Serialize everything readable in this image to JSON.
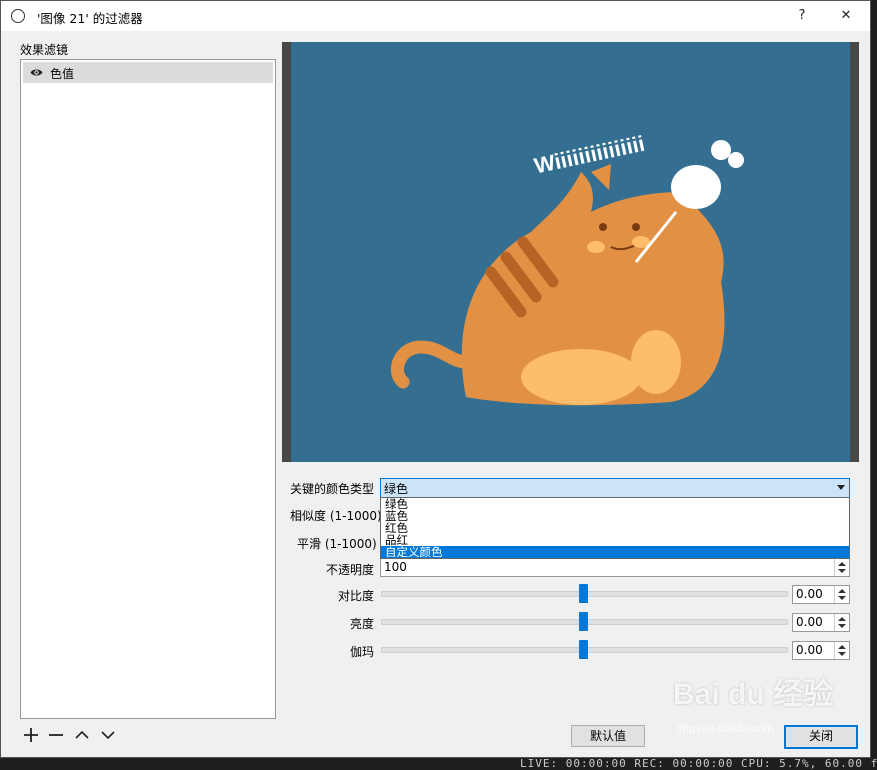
{
  "window": {
    "title": "'图像 21' 的过滤器",
    "help_label": "?",
    "close_label": "✕"
  },
  "left_panel": {
    "label": "效果滤镜",
    "filters": [
      {
        "name": "色值",
        "visible": true,
        "selected": true
      }
    ],
    "controls": {
      "add": "+",
      "remove": "−",
      "up": "up-chevron",
      "down": "down-chevron"
    }
  },
  "properties": {
    "key_color_type": {
      "label": "关键的颜色类型",
      "value": "绿色",
      "options": [
        "绿色",
        "蓝色",
        "红色",
        "品红",
        "自定义颜色"
      ],
      "highlighted": "自定义颜色"
    },
    "similarity_label": "相似度 (1-1000)",
    "smoothness_label": "平滑 (1-1000)",
    "opacity": {
      "label": "不透明度",
      "value": "100"
    },
    "contrast": {
      "label": "对比度",
      "value": "0.00",
      "level": 0.5
    },
    "brightness": {
      "label": "亮度",
      "value": "0.00",
      "level": 0.5
    },
    "gamma": {
      "label": "伽玛",
      "value": "0.00",
      "level": 0.5
    }
  },
  "buttons": {
    "defaults": "默认值",
    "close": "关闭"
  },
  "preview": {
    "text": "Wiiiiiiiiiiiiiii"
  },
  "status_bar": "LIVE: 00:00:00   REC: 00:00:00   CPU: 5.7%, 60.00 f",
  "watermark": {
    "brand": "Bai du 经验",
    "url": "jingyan.baidu.com"
  },
  "colors": {
    "accent": "#0078d7",
    "preview_bg": "#346f91",
    "cat": "#e29144",
    "cat_belly": "#fdbd6b",
    "stripes": "#b86326"
  }
}
